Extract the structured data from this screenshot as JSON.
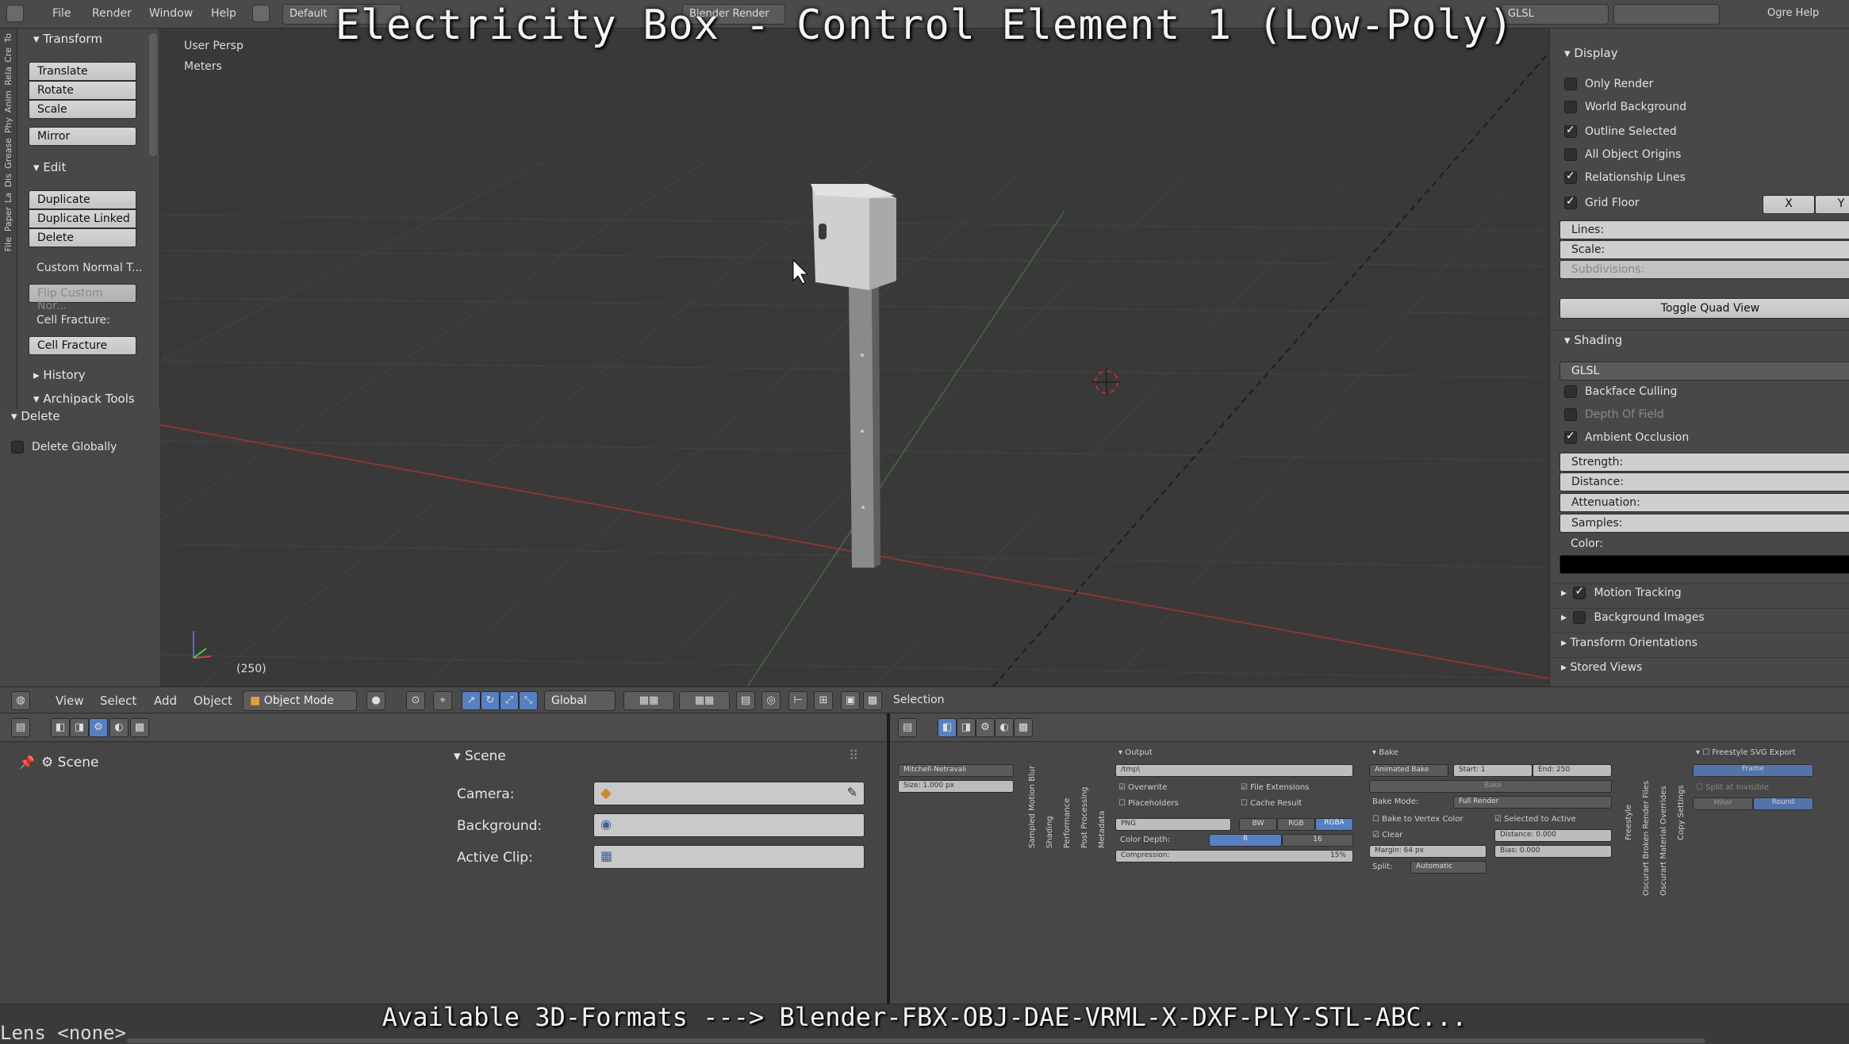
{
  "overlay_title": "Electricity Box - Control Element 1 (Low-Poly)",
  "top_menu": {
    "items": [
      "File",
      "Render",
      "Window",
      "Help"
    ],
    "screen_layout": "Default",
    "render_engine": "Blender Render",
    "viewport_shading": "GLSL",
    "help_text": "Ogre Help"
  },
  "tool_tabs": [
    "To",
    "Cre",
    "Rela",
    "Anim",
    "Phy",
    "Grease",
    "Dis",
    "La",
    "Paper",
    "File"
  ],
  "toolshelf": {
    "transform_header": "Transform",
    "translate": "Translate",
    "rotate": "Rotate",
    "scale": "Scale",
    "mirror": "Mirror",
    "edit_header": "Edit",
    "duplicate": "Duplicate",
    "duplicate_linked": "Duplicate Linked",
    "delete": "Delete",
    "custom_normal": "Custom Normal T...",
    "flip_custom": "Flip Custom Nor...",
    "cell_fracture_label": "Cell Fracture:",
    "cell_fracture_button": "Cell Fracture",
    "history_header": "History",
    "archipack_header": "Archipack Tools"
  },
  "last_operator": {
    "header": "Delete",
    "delete_globally": "Delete Globally"
  },
  "viewport": {
    "view_name": "User Persp",
    "units": "Meters",
    "frame": "(250)"
  },
  "npanel": {
    "display_header": "Display",
    "only_render": "Only Render",
    "world_background": "World Background",
    "outline_selected": "Outline Selected",
    "all_object_origins": "All Object Origins",
    "relationship_lines": "Relationship Lines",
    "grid_floor": "Grid Floor",
    "axis_x": "X",
    "axis_y": "Y",
    "lines": "Lines:",
    "scale": "Scale:",
    "subdivisions": "Subdivisions:",
    "toggle_quad_view": "Toggle Quad View",
    "shading_header": "Shading",
    "shading_mode": "GLSL",
    "backface_culling": "Backface Culling",
    "depth_of_field": "Depth Of Field",
    "ambient_occlusion": "Ambient Occlusion",
    "strength": "Strength:",
    "distance": "Distance:",
    "attenuation": "Attenuation:",
    "samples": "Samples:",
    "color": "Color:",
    "color_value": "#000000",
    "motion_tracking": "Motion Tracking",
    "background_images": "Background Images",
    "transform_orientations": "Transform Orientations",
    "stored_views": "Stored Views"
  },
  "view3d_header": {
    "view": "View",
    "select": "Select",
    "add": "Add",
    "object": "Object",
    "mode": "Object Mode",
    "orientation": "Global",
    "selection_label": "Selection"
  },
  "scene_props": {
    "breadcrumb": "Scene",
    "panel_header": "Scene",
    "camera_label": "Camera:",
    "background_label": "Background:",
    "active_clip_label": "Active Clip:"
  },
  "render_props": {
    "output_header": "Output",
    "output_path": "/tmp\\",
    "overwrite": "Overwrite",
    "file_extensions": "File Extensions",
    "placeholders": "Placeholders",
    "cache_result": "Cache Result",
    "file_format": "PNG",
    "bw": "BW",
    "rgb": "RGB",
    "rgba": "RGBA",
    "color_depth_label": "Color Depth:",
    "depth_8": "8",
    "depth_16": "16",
    "compression_label": "Compression:",
    "compression_value": "15%",
    "filter_name": "Mitchell-Netravali",
    "filter_size": "Size: 1.000 px",
    "vertical_tabs_1": [
      "Sampled Motion Blur",
      "Shading",
      "Performance",
      "Post Processing",
      "Metadata"
    ],
    "bake_header": "Bake",
    "animated_bake": "Animated Bake",
    "start": "Start: 1",
    "end": "End: 250",
    "bake_button": "Bake",
    "bake_mode_label": "Bake Mode:",
    "bake_mode_value": "Full Render",
    "bake_to_vertex_color": "Bake to Vertex Color",
    "selected_to_active": "Selected to Active",
    "clear": "Clear",
    "distance": "Distance: 0.000",
    "margin": "Margin: 64 px",
    "bias": "Bias: 0.000",
    "split_label": "Split:",
    "split_value": "Automatic",
    "vertical_tabs_2": [
      "Freestyle",
      "Oscurart Broken Render Files",
      "Oscurart Material Overrides",
      "Copy Settings"
    ],
    "freestyle_svg": "Freestyle SVG Export",
    "frame": "Frame",
    "split_at_invisible": "Split at Invisible",
    "miter": "Miter",
    "round": "Round"
  },
  "status": {
    "lens": "Lens <none>",
    "caption": "Available 3D-Formats ---> Blender-FBX-OBJ-DAE-VRML-X-DXF-PLY-STL-ABC..."
  }
}
